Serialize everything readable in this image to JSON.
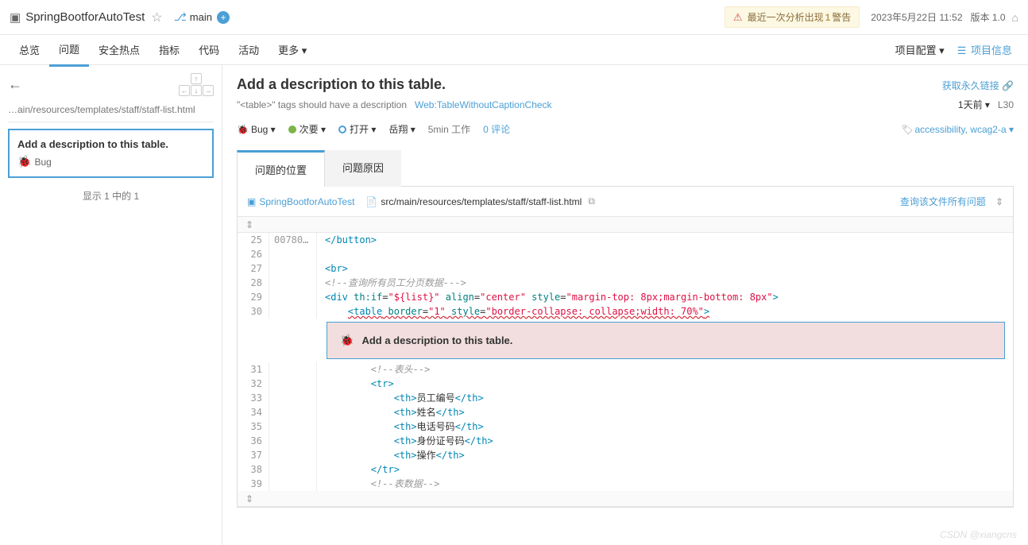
{
  "project": {
    "name": "SpringBootforAutoTest",
    "branch": "main"
  },
  "warn": {
    "prefix": "最近一次分析出现",
    "count": "1",
    "suffix": "警告"
  },
  "topmeta": {
    "date": "2023年5月22日 11:52",
    "version": "版本 1.0"
  },
  "nav": {
    "overview": "总览",
    "issues": "问题",
    "hotspots": "安全热点",
    "measures": "指标",
    "code": "代码",
    "activity": "活动",
    "more": "更多 ▾",
    "config": "项目配置 ▾",
    "info": "项目信息"
  },
  "sidebar": {
    "path": "…ain/resources/templates/staff/staff-list.html",
    "issue_title": "Add a description to this table.",
    "issue_type": "Bug",
    "pager": "显示 1 中的 1"
  },
  "main": {
    "title": "Add a description to this table.",
    "permalink": "获取永久链接",
    "rule_desc": "\"<table>\" tags should have a description",
    "rule_key": "Web:TableWithoutCaptionCheck",
    "age": "1天前 ▾",
    "line": "L30",
    "type": "Bug ▾",
    "severity": "次要 ▾",
    "status": "打开 ▾",
    "assignee": "岳翔 ▾",
    "effort": "5min 工作",
    "comments": "0 评论",
    "tags": "accessibility, wcag2-a ▾"
  },
  "tabs": {
    "where": "问题的位置",
    "why": "问题原因"
  },
  "codehead": {
    "project": "SpringBootforAutoTest",
    "path": "src/main/resources/templates/staff/staff-list.html",
    "all_issues": "查询该文件所有问题"
  },
  "code": {
    "l25": {
      "n": "25",
      "cov": "00780…"
    },
    "l26": {
      "n": "26"
    },
    "l27": {
      "n": "27"
    },
    "l28": {
      "n": "28"
    },
    "l29": {
      "n": "29"
    },
    "l30": {
      "n": "30"
    },
    "l31": {
      "n": "31"
    },
    "l32": {
      "n": "32"
    },
    "l33": {
      "n": "33"
    },
    "l34": {
      "n": "34"
    },
    "l35": {
      "n": "35"
    },
    "l36": {
      "n": "36"
    },
    "l37": {
      "n": "37"
    },
    "l38": {
      "n": "38"
    },
    "l39": {
      "n": "39"
    },
    "txt28": "<!--查询所有员工分页数据--->",
    "txt30_style": "\"border-collapse: collapse;width: 70%\"",
    "th1": "员工编号",
    "th2": "姓名",
    "th3": "电话号码",
    "th4": "身份证号码",
    "th5": "操作",
    "cmt31": "<!--表头-->",
    "cmt39": "<!--表数据-->"
  },
  "issue_inline": "Add a description to this table.",
  "watermark": "CSDN @xiangcns"
}
